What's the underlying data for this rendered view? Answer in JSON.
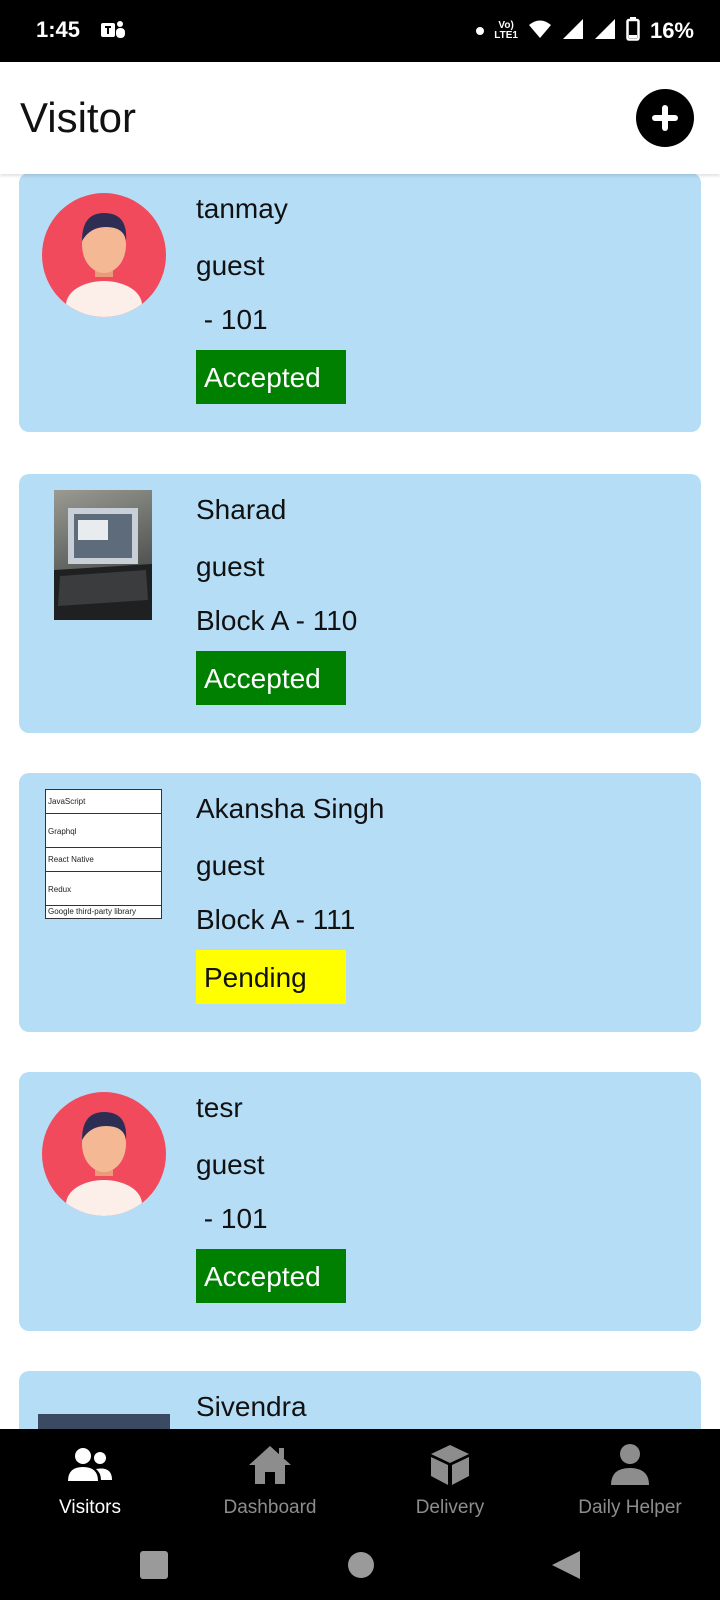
{
  "status_bar": {
    "time": "1:45",
    "network": "Vo) LTE1",
    "battery": "16%"
  },
  "header": {
    "title": "Visitor",
    "add_icon": "plus-circle-icon"
  },
  "visitors": [
    {
      "name": "tanmay",
      "type": "guest",
      "flat": " - 101",
      "status": "Accepted",
      "avatar": "default-avatar"
    },
    {
      "name": "Sharad",
      "type": "guest",
      "flat": "Block A - 110",
      "status": "Accepted",
      "avatar": "laptop-photo"
    },
    {
      "name": "Akansha Singh",
      "type": "guest",
      "flat": "Block A - 111",
      "status": "Pending",
      "avatar": "document-image",
      "doc_lines": [
        "JavaScript",
        "Graphql",
        "React Native",
        "Redux",
        "Google third-party library"
      ]
    },
    {
      "name": "tesr",
      "type": "guest",
      "flat": " - 101",
      "status": "Accepted",
      "avatar": "default-avatar"
    },
    {
      "name": "Sivendra",
      "avatar": "photo"
    }
  ],
  "status_colors": {
    "Accepted": "#008000",
    "Pending": "#ffff00"
  },
  "card_color": "#b5ddf6",
  "bottom_nav": [
    {
      "label": "Visitors",
      "icon": "users-icon",
      "active": true
    },
    {
      "label": "Dashboard",
      "icon": "home-icon",
      "active": false
    },
    {
      "label": "Delivery",
      "icon": "box-icon",
      "active": false
    },
    {
      "label": "Daily Helper",
      "icon": "person-icon",
      "active": false
    }
  ]
}
